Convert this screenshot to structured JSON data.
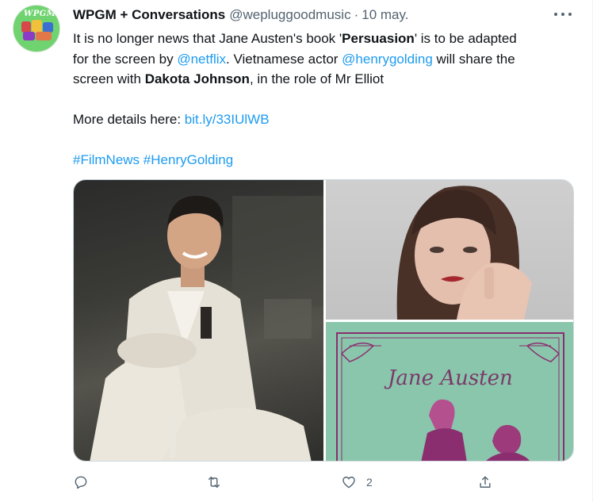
{
  "tweet": {
    "author": {
      "name": "WPGM + Conversations",
      "handle": "@wepluggoodmusic",
      "separator": "·",
      "date": "10 may.",
      "avatar_text": "WPGM"
    },
    "body": {
      "line1": {
        "pre": "It is no longer news that Jane Austen's book '",
        "bold": "Persuasion",
        "post": "' is to be adapted"
      },
      "line2": {
        "pre": "for the screen by ",
        "mention": "@netflix",
        "post": ". Vietnamese actor ",
        "mention2": "@henrygolding",
        "post2": " will share the"
      },
      "line3": {
        "pre": "screen with ",
        "bold": "Dakota Johnson",
        "post": ", in the role of Mr Elliot"
      },
      "line4": {
        "pre": "More details here: ",
        "link": "bit.ly/33IUlWB"
      },
      "hashtags": [
        "#FilmNews",
        "#HenryGolding"
      ]
    },
    "media": {
      "book_cover_text": "Jane Austen"
    },
    "actions": {
      "reply_count": "",
      "retweet_count": "",
      "like_count": "2",
      "share_count": ""
    }
  },
  "colors": {
    "accent": "#1d9bf0",
    "secondary_text": "#536471",
    "book_cover": "#8ac6ab",
    "book_ornament": "#8b2e6f"
  },
  "icons": [
    "more-icon",
    "reply-icon",
    "retweet-icon",
    "like-icon",
    "share-icon"
  ]
}
